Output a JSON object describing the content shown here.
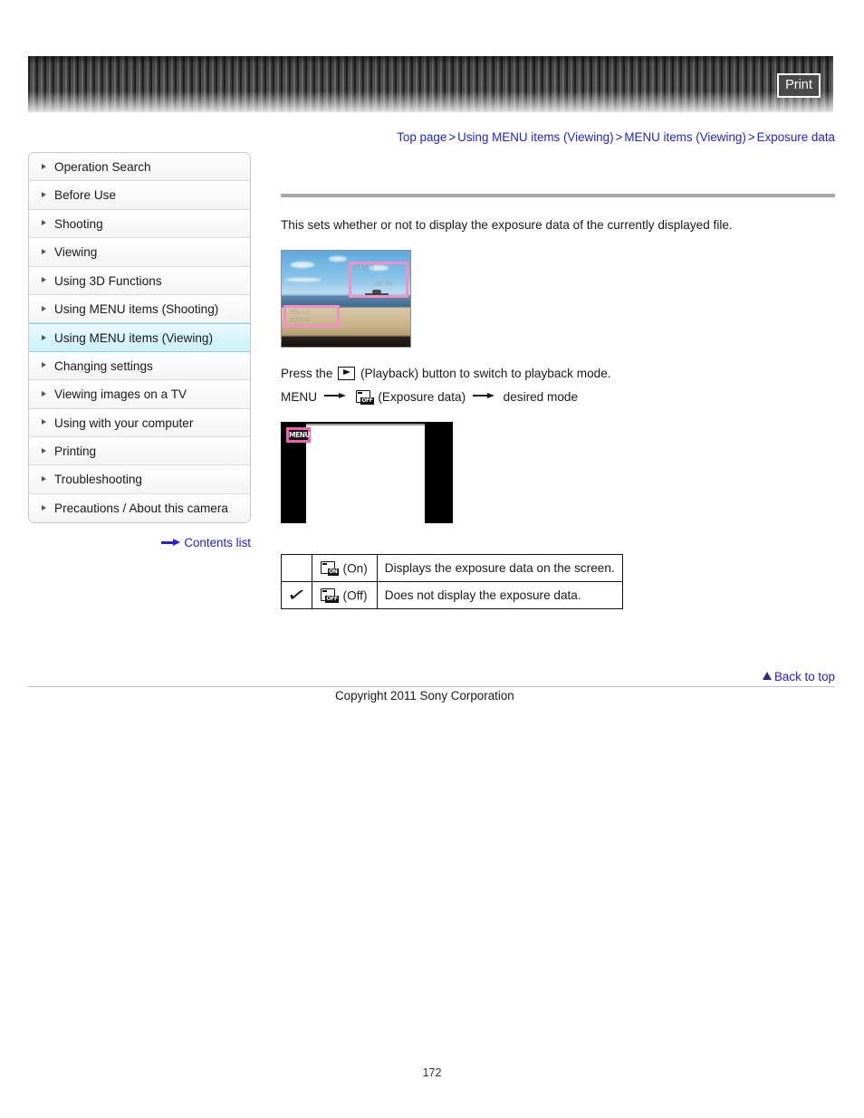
{
  "header": {
    "print_label": "Print"
  },
  "breadcrumb": {
    "separator": ">",
    "items": [
      {
        "label": "Top page"
      },
      {
        "label": "Using MENU items (Viewing)"
      },
      {
        "label": "MENU items (Viewing)"
      },
      {
        "label": "Exposure data"
      }
    ]
  },
  "sidebar": {
    "items": [
      {
        "label": "Operation Search",
        "selected": false
      },
      {
        "label": "Before Use",
        "selected": false
      },
      {
        "label": "Shooting",
        "selected": false
      },
      {
        "label": "Viewing",
        "selected": false
      },
      {
        "label": "Using 3D Functions",
        "selected": false
      },
      {
        "label": "Using MENU items (Shooting)",
        "selected": false
      },
      {
        "label": "Using MENU items (Viewing)",
        "selected": true
      },
      {
        "label": "Changing settings",
        "selected": false
      },
      {
        "label": "Viewing images on a TV",
        "selected": false
      },
      {
        "label": "Using with your computer",
        "selected": false
      },
      {
        "label": "Printing",
        "selected": false
      },
      {
        "label": "Troubleshooting",
        "selected": false
      },
      {
        "label": "Precautions / About this camera",
        "selected": false
      }
    ],
    "contents_list_label": "Contents list"
  },
  "main": {
    "page_title": "",
    "intro": "This sets whether or not to display the exposure data of the currently displayed file.",
    "sample_photo": {
      "overlay_top": "100 F3.5",
      "overlay_top2": "ISO 400",
      "overlay_bottom": "2011-1-1",
      "overlay_bottom2": "10:30 AM"
    },
    "steps": {
      "step1_before": "Press the",
      "step1_after": "(Playback) button to switch to playback mode.",
      "step2_menu": "MENU",
      "step2_icon_label": "(Exposure data)",
      "step2_end": "desired mode"
    },
    "menu_screen": {
      "badge_label": "MENU"
    },
    "options_table": {
      "rows": [
        {
          "checked": "",
          "icon_tag": "ON",
          "mode": "(On)",
          "description": "Displays the exposure data on the screen."
        },
        {
          "checked": "✓",
          "icon_tag": "OFF",
          "mode": "(Off)",
          "description": "Does not display the exposure data."
        }
      ]
    }
  },
  "footer": {
    "back_to_top_label": "Back to top",
    "copyright": "Copyright 2011 Sony Corporation",
    "page_number": "172"
  }
}
